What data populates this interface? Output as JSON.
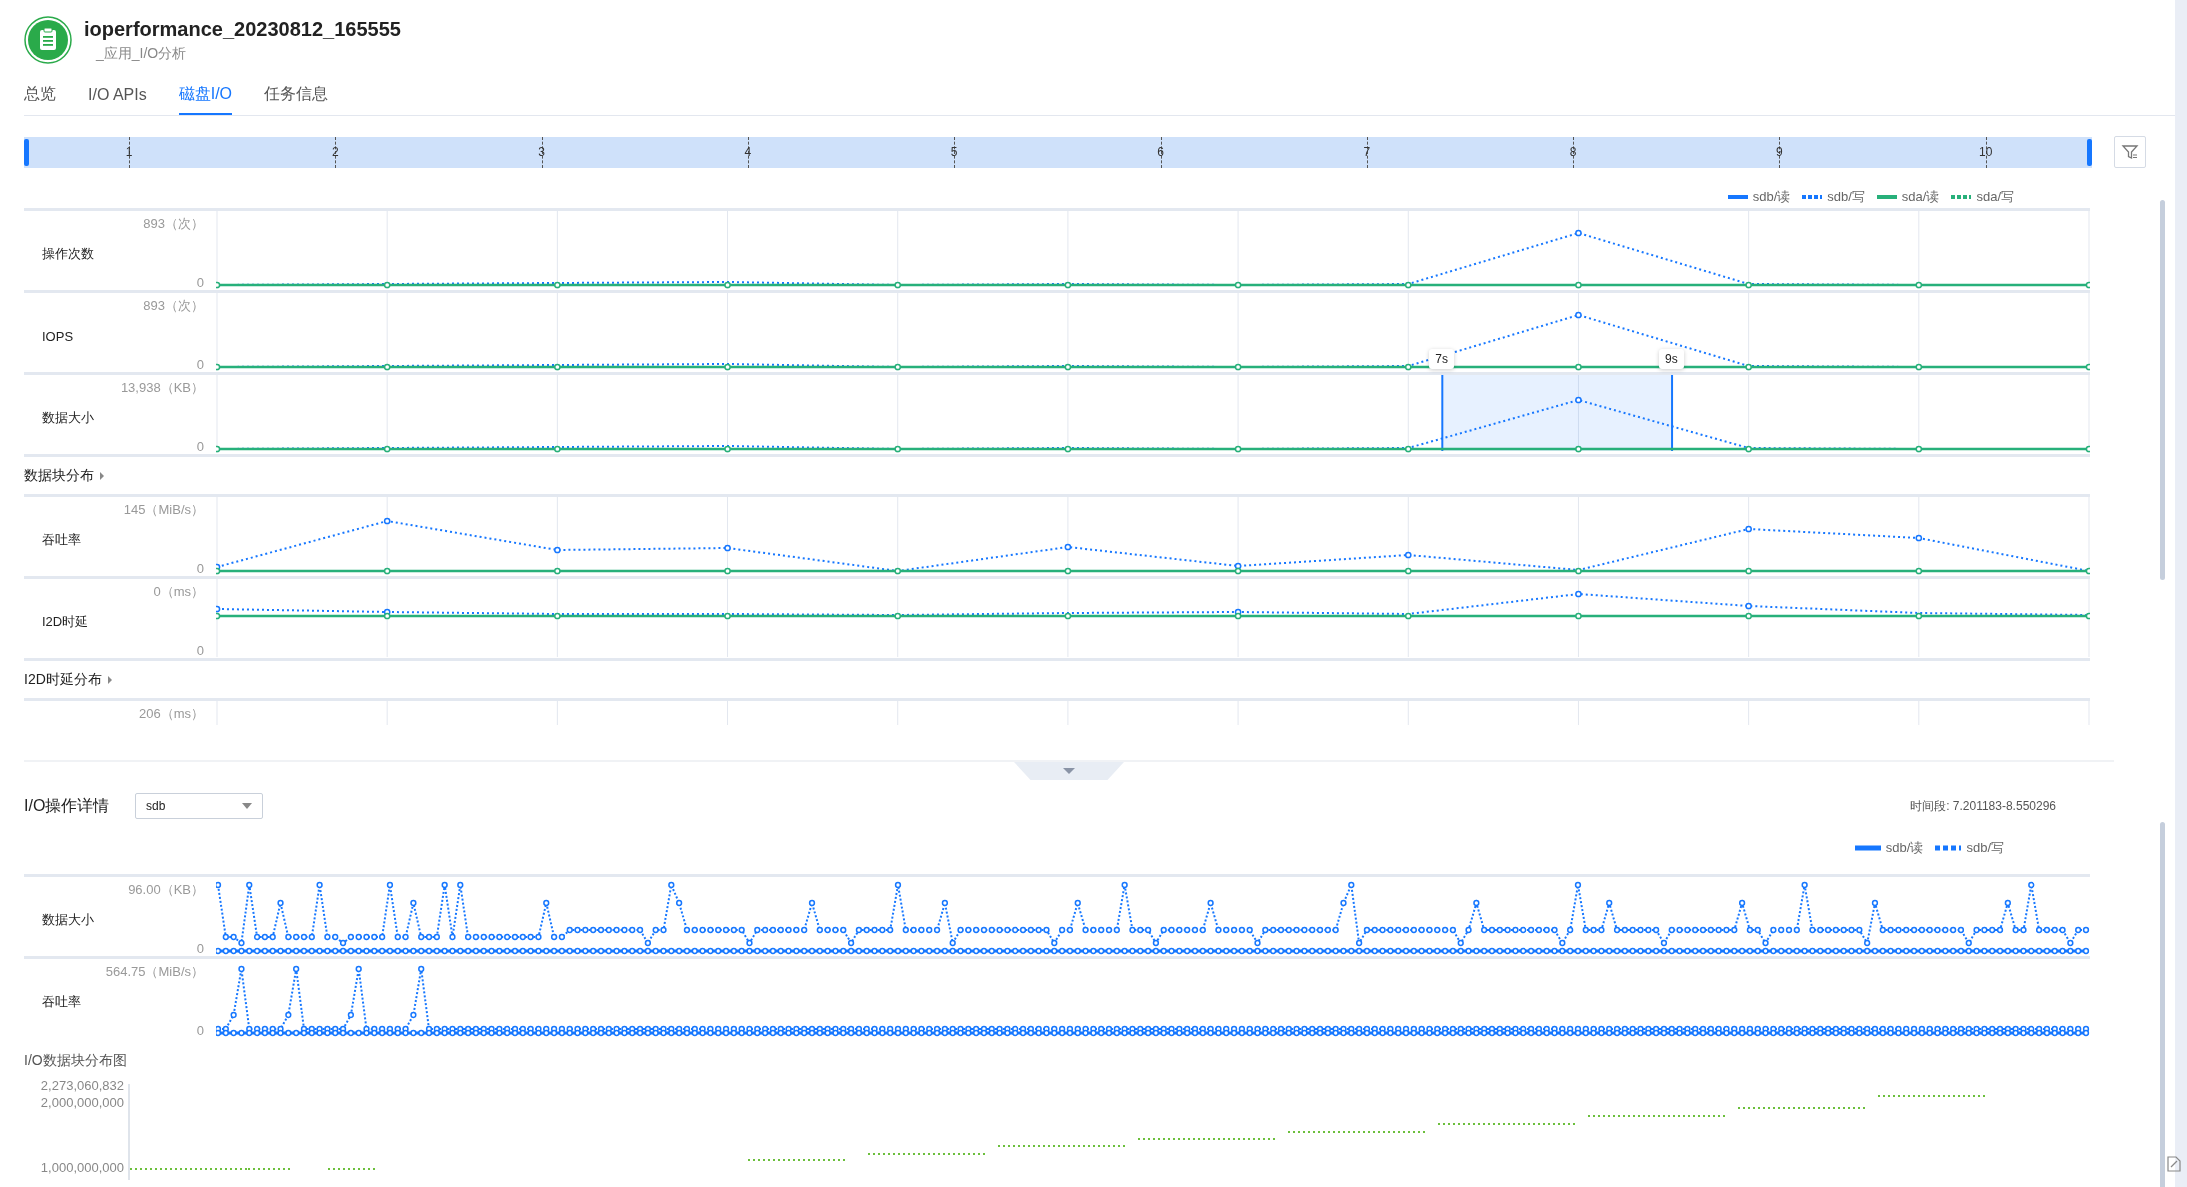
{
  "header": {
    "title": "ioperformance_20230812_165555",
    "subtitle": "_应用_I/O分析"
  },
  "tabs": [
    {
      "label": "总览",
      "selected": false
    },
    {
      "label": "I/O APIs",
      "selected": false
    },
    {
      "label": "磁盘I/O",
      "selected": true
    },
    {
      "label": "任务信息",
      "selected": false
    }
  ],
  "timeline": {
    "ticks": [
      "1",
      "2",
      "3",
      "4",
      "5",
      "6",
      "7",
      "8",
      "9",
      "10"
    ],
    "level": 1
  },
  "legend": [
    {
      "name": "sdb/读",
      "color": "#1677ff",
      "kind": "solid"
    },
    {
      "name": "sdb/写",
      "color": "#1677ff",
      "kind": "dotted"
    },
    {
      "name": "sda/读",
      "color": "#27b07a",
      "kind": "solid"
    },
    {
      "name": "sda/写",
      "color": "#27b07a",
      "kind": "dotted"
    }
  ],
  "panels": [
    {
      "kind": "chart",
      "label": "操作次数",
      "max_label": "893（次）",
      "min_label": "0"
    },
    {
      "kind": "chart",
      "label": "IOPS",
      "max_label": "893（次）",
      "min_label": "0"
    },
    {
      "kind": "chart",
      "label": "数据大小",
      "max_label": "13,938（KB）",
      "min_label": "0",
      "selection": {
        "start_label": "7s",
        "end_label": "9s"
      }
    },
    {
      "kind": "section",
      "label": "数据块分布",
      "expanded": false
    },
    {
      "kind": "chart",
      "label": "吞吐率",
      "max_label": "145（MiB/s）",
      "min_label": "0"
    },
    {
      "kind": "chart",
      "label": "I2D时延",
      "max_label": "0（ms）",
      "min_label": "0"
    },
    {
      "kind": "section",
      "label": "I2D时延分布",
      "expanded": false
    },
    {
      "kind": "partial",
      "max_label": "206（ms）"
    }
  ],
  "detail": {
    "title": "I/O操作详情",
    "device": "sdb",
    "time_range": "时间段: 7.201183-8.550296",
    "legend": [
      {
        "name": "sdb/读",
        "color": "#1677ff",
        "kind": "solid"
      },
      {
        "name": "sdb/写",
        "color": "#1677ff",
        "kind": "dashed"
      }
    ],
    "charts": [
      {
        "kind": "size",
        "label": "数据大小",
        "max_label": "96.00（KB）",
        "min_label": "0"
      },
      {
        "kind": "throughput",
        "label": "吞吐率",
        "max_label": "564.75（MiB/s）",
        "min_label": "0"
      }
    ],
    "block_chart": {
      "title": "I/O数据块分布图",
      "tick_labels": [
        "2,273,060,832",
        "2,000,000,000",
        "1,000,000,000"
      ]
    }
  }
}
